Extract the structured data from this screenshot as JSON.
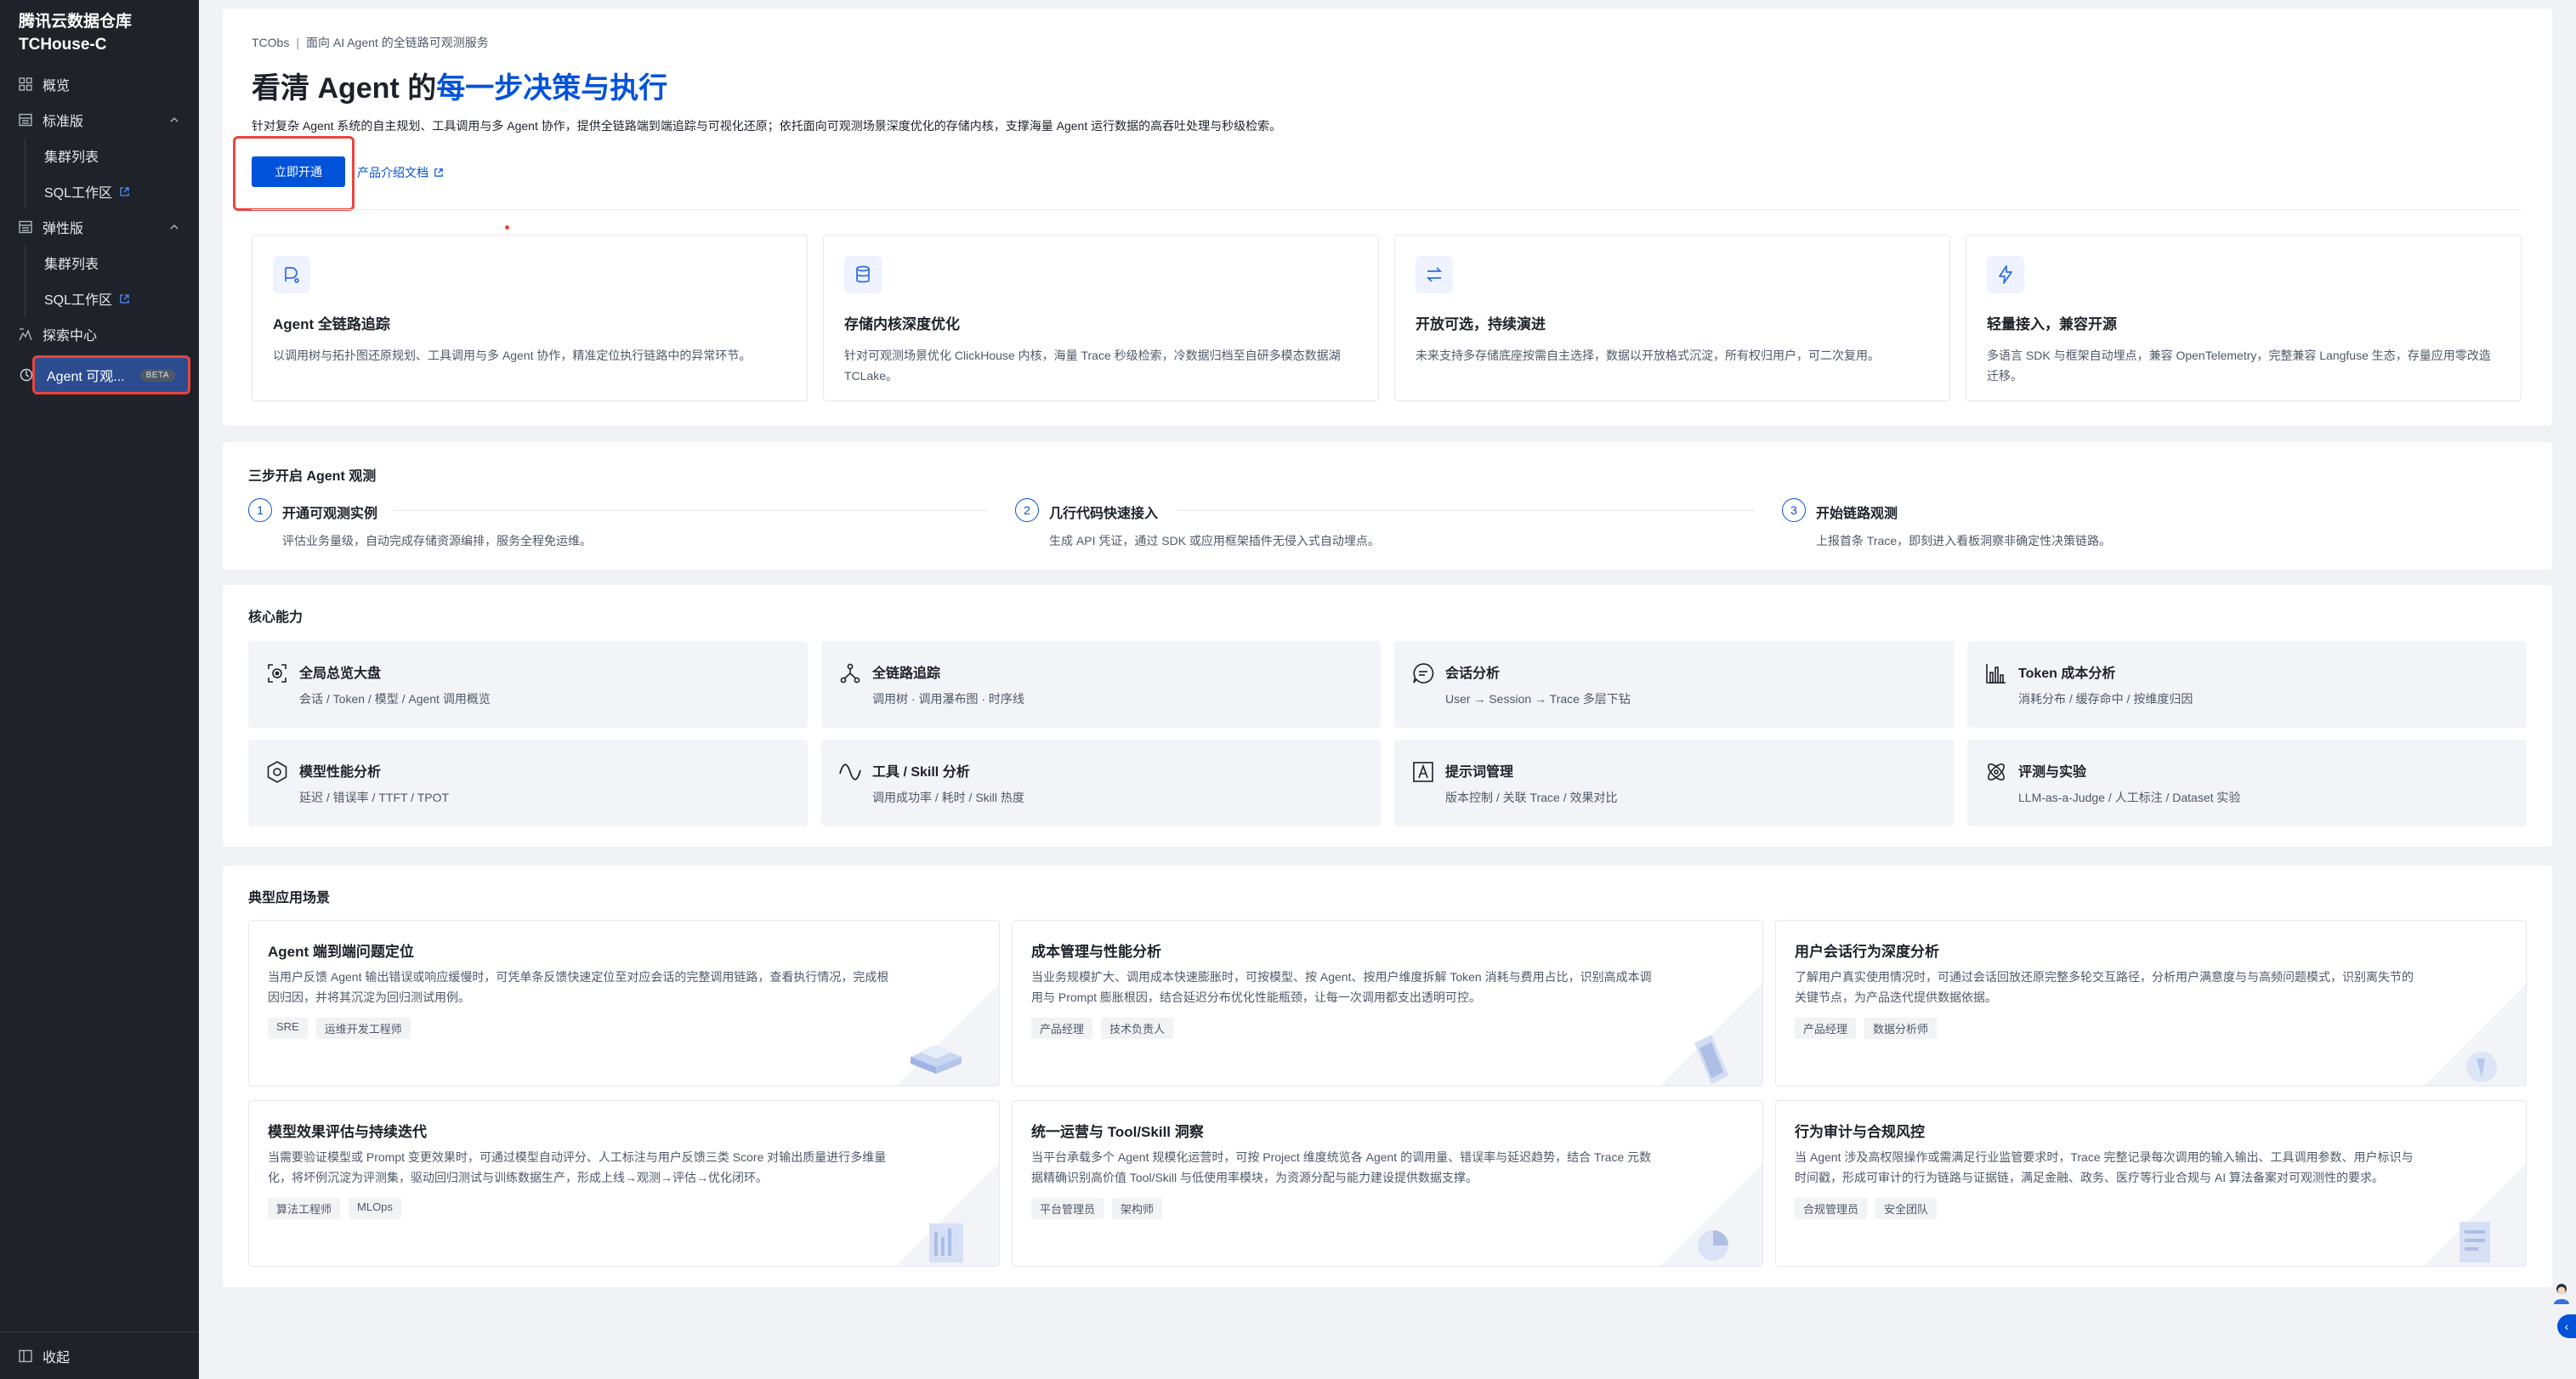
{
  "sidebar": {
    "brand_line1": "腾讯云数据仓库",
    "brand_line2": "TCHouse-C",
    "overview": "概览",
    "standard": "标准版",
    "standard_cluster": "集群列表",
    "standard_sql": "SQL工作区",
    "elastic": "弹性版",
    "elastic_cluster": "集群列表",
    "elastic_sql": "SQL工作区",
    "explore": "探索中心",
    "agent": "Agent 可观...",
    "beta": "BETA",
    "collapse": "收起"
  },
  "hero": {
    "breadcrumb_root": "TCObs",
    "breadcrumb_sep": "|",
    "breadcrumb_current": "面向 AI Agent 的全链路可观测服务",
    "title_plain": "看清 Agent 的",
    "title_highlight": "每一步决策与执行",
    "description": "针对复杂 Agent 系统的自主规划、工具调用与多 Agent 协作，提供全链路端到端追踪与可视化还原；依托面向可观测场景深度优化的存储内核，支撑海量 Agent 运行数据的高吞吐处理与秒级检索。",
    "primary_button": "立即开通",
    "doc_link": "产品介绍文档"
  },
  "features": [
    {
      "icon": "trace-icon",
      "title": "Agent 全链路追踪",
      "desc": "以调用树与拓扑图还原规划、工具调用与多 Agent 协作，精准定位执行链路中的异常环节。"
    },
    {
      "icon": "database-icon",
      "title": "存储内核深度优化",
      "desc": "针对可观测场景优化 ClickHouse 内核，海量 Trace 秒级检索，冷数据归档至自研多模态数据湖 TCLake。"
    },
    {
      "icon": "swap-icon",
      "title": "开放可选，持续演进",
      "desc": "未来支持多存储底座按需自主选择，数据以开放格式沉淀，所有权归用户，可二次复用。"
    },
    {
      "icon": "lightning-icon",
      "title": "轻量接入，兼容开源",
      "desc": "多语言 SDK 与框架自动埋点，兼容 OpenTelemetry，完整兼容 Langfuse 生态，存量应用零改造迁移。"
    }
  ],
  "steps": {
    "title": "三步开启 Agent 观测",
    "items": [
      {
        "num": "1",
        "title": "开通可观测实例",
        "desc": "评估业务量级，自动完成存储资源编排，服务全程免运维。"
      },
      {
        "num": "2",
        "title": "几行代码快速接入",
        "desc": "生成 API 凭证，通过 SDK 或应用框架插件无侵入式自动埋点。"
      },
      {
        "num": "3",
        "title": "开始链路观测",
        "desc": "上报首条 Trace，即刻进入看板洞察非确定性决策链路。"
      }
    ]
  },
  "core": {
    "title": "核心能力",
    "items": [
      {
        "icon": "dashboard-icon",
        "title": "全局总览大盘",
        "desc": "会话 / Token / 模型 / Agent 调用概览"
      },
      {
        "icon": "network-icon",
        "title": "全链路追踪",
        "desc": "调用树 · 调用瀑布图 · 时序线"
      },
      {
        "icon": "chat-icon",
        "title": "会话分析",
        "desc": "User → Session → Trace 多层下钻"
      },
      {
        "icon": "bar-chart-icon",
        "title": "Token 成本分析",
        "desc": "消耗分布 / 缓存命中 / 按维度归因"
      },
      {
        "icon": "model-icon",
        "title": "模型性能分析",
        "desc": "延迟 / 错误率 / TTFT / TPOT"
      },
      {
        "icon": "wave-icon",
        "title": "工具 / Skill 分析",
        "desc": "调用成功率 / 耗时 / Skill 热度"
      },
      {
        "icon": "prompt-icon",
        "title": "提示词管理",
        "desc": "版本控制 / 关联 Trace / 效果对比"
      },
      {
        "icon": "atom-icon",
        "title": "评测与实验",
        "desc": "LLM-as-a-Judge / 人工标注 / Dataset 实验"
      }
    ]
  },
  "scenarios": {
    "title": "典型应用场景",
    "items": [
      {
        "title": "Agent 端到端问题定位",
        "desc": "当用户反馈 Agent 输出错误或响应缓慢时，可凭单条反馈快速定位至对应会话的完整调用链路，查看执行情况，完成根因归因，并将其沉淀为回归测试用例。",
        "tags": [
          "SRE",
          "运维开发工程师"
        ]
      },
      {
        "title": "成本管理与性能分析",
        "desc": "当业务规模扩大、调用成本快速膨胀时，可按模型、按 Agent、按用户维度拆解 Token 消耗与费用占比，识别高成本调用与 Prompt 膨胀根因，结合延迟分布优化性能瓶颈，让每一次调用都支出透明可控。",
        "tags": [
          "产品经理",
          "技术负责人"
        ]
      },
      {
        "title": "用户会话行为深度分析",
        "desc": "了解用户真实使用情况时，可通过会话回放还原完整多轮交互路径，分析用户满意度与与高频问题模式，识别离失节的关键节点，为产品迭代提供数据依据。",
        "tags": [
          "产品经理",
          "数据分析师"
        ]
      },
      {
        "title": "模型效果评估与持续迭代",
        "desc": "当需要验证模型或 Prompt 变更效果时，可通过模型自动评分、人工标注与用户反馈三类 Score 对输出质量进行多维量化，将坏例沉淀为评测集，驱动回归测试与训练数据生产，形成上线→观测→评估→优化闭环。",
        "tags": [
          "算法工程师",
          "MLOps"
        ]
      },
      {
        "title": "统一运营与 Tool/Skill 洞察",
        "desc": "当平台承载多个 Agent 规模化运营时，可按 Project 维度统览各 Agent 的调用量、错误率与延迟趋势，结合 Trace 元数据精确识别高价值 Tool/Skill 与低使用率模块，为资源分配与能力建设提供数据支撑。",
        "tags": [
          "平台管理员",
          "架构师"
        ]
      },
      {
        "title": "行为审计与合规风控",
        "desc": "当 Agent 涉及高权限操作或需满足行业监管要求时，Trace 完整记录每次调用的输入输出、工具调用参数、用户标识与时间戳，形成可审计的行为链路与证据链，满足金融、政务、医疗等行业合规与 AI 算法备案对可观测性的要求。",
        "tags": [
          "合规管理员",
          "安全团队"
        ]
      }
    ]
  },
  "colors": {
    "accent": "#0052d9",
    "sidebar_bg": "#1f2329",
    "highlight_border": "#e8453c"
  }
}
